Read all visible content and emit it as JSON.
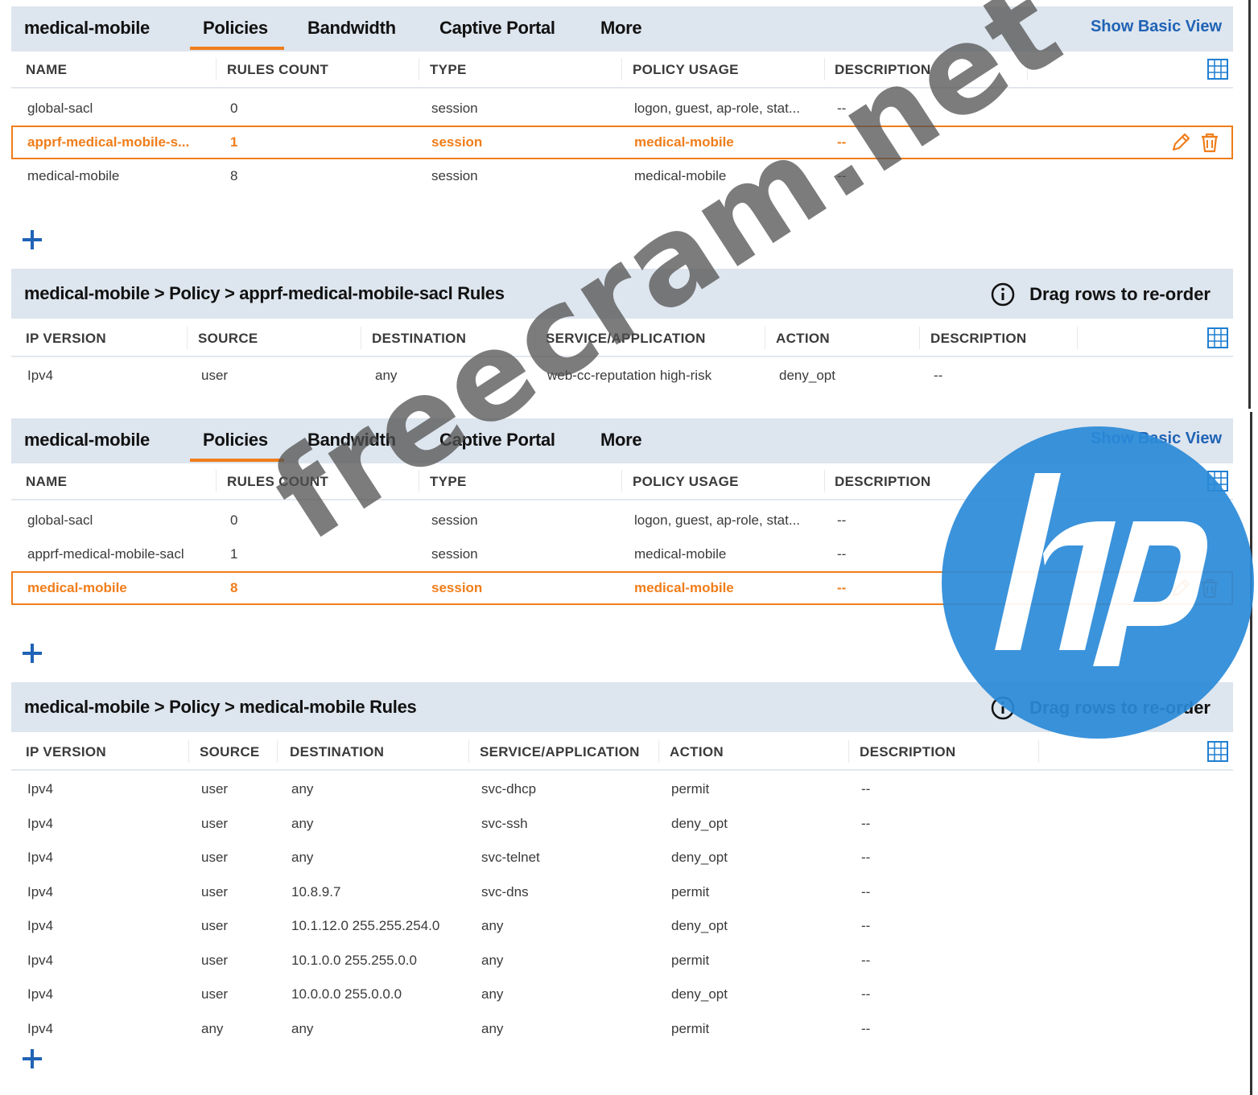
{
  "screen1": {
    "header": {
      "title": "medical-mobile",
      "tabs": [
        "Policies",
        "Bandwidth",
        "Captive Portal",
        "More"
      ],
      "active_tab": "Policies",
      "show_basic_view": "Show Basic View"
    },
    "policies_table": {
      "columns": [
        "NAME",
        "RULES COUNT",
        "TYPE",
        "POLICY USAGE",
        "DESCRIPTION"
      ],
      "rows": [
        {
          "name": "global-sacl",
          "rules": "0",
          "type": "session",
          "usage": "logon, guest, ap-role, stat...",
          "desc": "--"
        },
        {
          "name": "apprf-medical-mobile-s...",
          "rules": "1",
          "type": "session",
          "usage": "medical-mobile",
          "desc": "--"
        },
        {
          "name": "medical-mobile",
          "rules": "8",
          "type": "session",
          "usage": "medical-mobile",
          "desc": "--"
        }
      ],
      "selected_row": 1
    },
    "rules": {
      "title": "medical-mobile > Policy > apprf-medical-mobile-sacl Rules",
      "reorder_hint": "Drag rows to re-order",
      "columns": [
        "IP VERSION",
        "SOURCE",
        "DESTINATION",
        "SERVICE/APPLICATION",
        "ACTION",
        "DESCRIPTION"
      ],
      "rows": [
        {
          "ip": "Ipv4",
          "src": "user",
          "dst": "any",
          "svc": "web-cc-reputation high-risk",
          "action": "deny_opt",
          "desc": "--"
        }
      ]
    }
  },
  "screen2": {
    "header": {
      "title": "medical-mobile",
      "tabs": [
        "Policies",
        "Bandwidth",
        "Captive Portal",
        "More"
      ],
      "active_tab": "Policies",
      "show_basic_view": "Show Basic View"
    },
    "policies_table": {
      "columns": [
        "NAME",
        "RULES COUNT",
        "TYPE",
        "POLICY USAGE",
        "DESCRIPTION"
      ],
      "rows": [
        {
          "name": "global-sacl",
          "rules": "0",
          "type": "session",
          "usage": "logon, guest, ap-role, stat...",
          "desc": "--"
        },
        {
          "name": "apprf-medical-mobile-sacl",
          "rules": "1",
          "type": "session",
          "usage": "medical-mobile",
          "desc": "--"
        },
        {
          "name": "medical-mobile",
          "rules": "8",
          "type": "session",
          "usage": "medical-mobile",
          "desc": "--"
        }
      ],
      "selected_row": 2
    },
    "rules": {
      "title": "medical-mobile > Policy > medical-mobile Rules",
      "reorder_hint": "Drag rows to re-order",
      "columns": [
        "IP VERSION",
        "SOURCE",
        "DESTINATION",
        "SERVICE/APPLICATION",
        "ACTION",
        "DESCRIPTION"
      ],
      "rows": [
        {
          "ip": "Ipv4",
          "src": "user",
          "dst": "any",
          "svc": "svc-dhcp",
          "action": "permit",
          "desc": "--"
        },
        {
          "ip": "Ipv4",
          "src": "user",
          "dst": "any",
          "svc": "svc-ssh",
          "action": "deny_opt",
          "desc": "--"
        },
        {
          "ip": "Ipv4",
          "src": "user",
          "dst": "any",
          "svc": "svc-telnet",
          "action": "deny_opt",
          "desc": "--"
        },
        {
          "ip": "Ipv4",
          "src": "user",
          "dst": "10.8.9.7",
          "svc": "svc-dns",
          "action": "permit",
          "desc": "--"
        },
        {
          "ip": "Ipv4",
          "src": "user",
          "dst": "10.1.12.0 255.255.254.0",
          "svc": "any",
          "action": "deny_opt",
          "desc": "--"
        },
        {
          "ip": "Ipv4",
          "src": "user",
          "dst": "10.1.0.0 255.255.0.0",
          "svc": "any",
          "action": "permit",
          "desc": "--"
        },
        {
          "ip": "Ipv4",
          "src": "user",
          "dst": "10.0.0.0 255.0.0.0",
          "svc": "any",
          "action": "deny_opt",
          "desc": "--"
        },
        {
          "ip": "Ipv4",
          "src": "any",
          "dst": "any",
          "svc": "any",
          "action": "permit",
          "desc": "--"
        }
      ]
    }
  },
  "watermark": {
    "text": "freecram.net",
    "logo_text": "hp",
    "logo_color": "#2b8ad8"
  },
  "colors": {
    "accent": "#f07d1a",
    "link": "#1f63b5",
    "header_bg": "#dde5ee"
  }
}
